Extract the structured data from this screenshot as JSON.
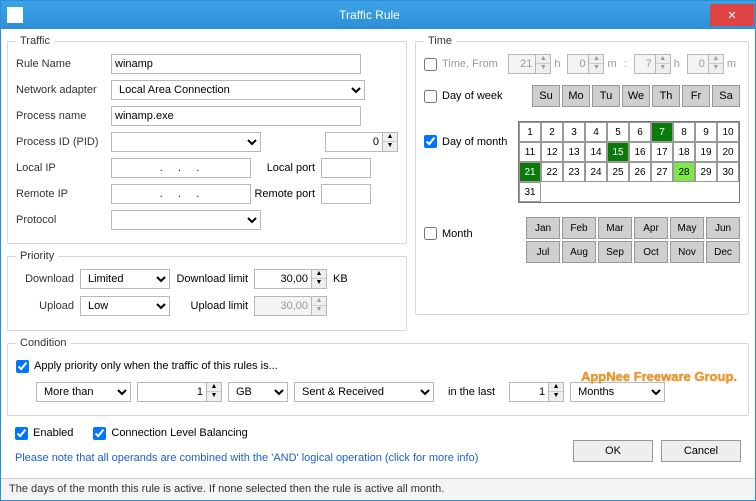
{
  "window": {
    "title": "Traffic Rule"
  },
  "traffic": {
    "legend": "Traffic",
    "ruleName": {
      "label": "Rule Name",
      "value": "winamp"
    },
    "adapter": {
      "label": "Network adapter",
      "value": "Local Area Connection"
    },
    "process": {
      "label": "Process name",
      "value": "winamp.exe"
    },
    "pid": {
      "label": "Process ID (PID)",
      "select": "",
      "spin": "0"
    },
    "localIp": {
      "label": "Local IP",
      "value": "  .     .     .   ",
      "portLabel": "Local port",
      "port": ""
    },
    "remoteIp": {
      "label": "Remote IP",
      "value": "  .     .     .   ",
      "portLabel": "Remote port",
      "port": ""
    },
    "protocol": {
      "label": "Protocol",
      "value": ""
    }
  },
  "priority": {
    "legend": "Priority",
    "download": {
      "label": "Download",
      "value": "Limited",
      "limitLabel": "Download limit",
      "limit": "30,00"
    },
    "upload": {
      "label": "Upload",
      "value": "Low",
      "limitLabel": "Upload limit",
      "limit": "30,00"
    },
    "unit": "KB"
  },
  "time": {
    "legend": "Time",
    "from": {
      "label": "Time, From",
      "h1": "21",
      "m1": "0",
      "h2": "7",
      "m2": "0",
      "checked": false
    },
    "dow": {
      "label": "Day of week",
      "checked": false,
      "days": [
        "Su",
        "Mo",
        "Tu",
        "We",
        "Th",
        "Fr",
        "Sa"
      ]
    },
    "dom": {
      "label": "Day of month",
      "checked": true,
      "days": [
        1,
        2,
        3,
        4,
        5,
        6,
        7,
        8,
        9,
        10,
        11,
        12,
        13,
        14,
        15,
        16,
        17,
        18,
        19,
        20,
        21,
        22,
        23,
        24,
        25,
        26,
        27,
        28,
        29,
        30,
        31
      ],
      "selected": [
        7,
        15,
        21
      ],
      "highlight": [
        28
      ]
    },
    "month": {
      "label": "Month",
      "checked": false,
      "months": [
        "Jan",
        "Feb",
        "Mar",
        "Apr",
        "May",
        "Jun",
        "Jul",
        "Aug",
        "Sep",
        "Oct",
        "Nov",
        "Dec"
      ]
    }
  },
  "condition": {
    "legend": "Condition",
    "apply": {
      "label": "Apply priority only when the traffic of this rules is...",
      "checked": true
    },
    "cmp": "More than",
    "amount": "1",
    "unit": "GB",
    "dir": "Sent & Received",
    "inlast": "in the last",
    "n": "1",
    "period": "Months"
  },
  "flags": {
    "enabled": {
      "label": "Enabled",
      "checked": true
    },
    "balancing": {
      "label": "Connection Level Balancing",
      "checked": true
    }
  },
  "note": "Please note that all operands are combined with the 'AND' logical operation (click for more info)",
  "buttons": {
    "ok": "OK",
    "cancel": "Cancel"
  },
  "status": "The days of the month this rule is active. If none selected then the rule is active all month.",
  "watermark": "AppNee Freeware Group."
}
